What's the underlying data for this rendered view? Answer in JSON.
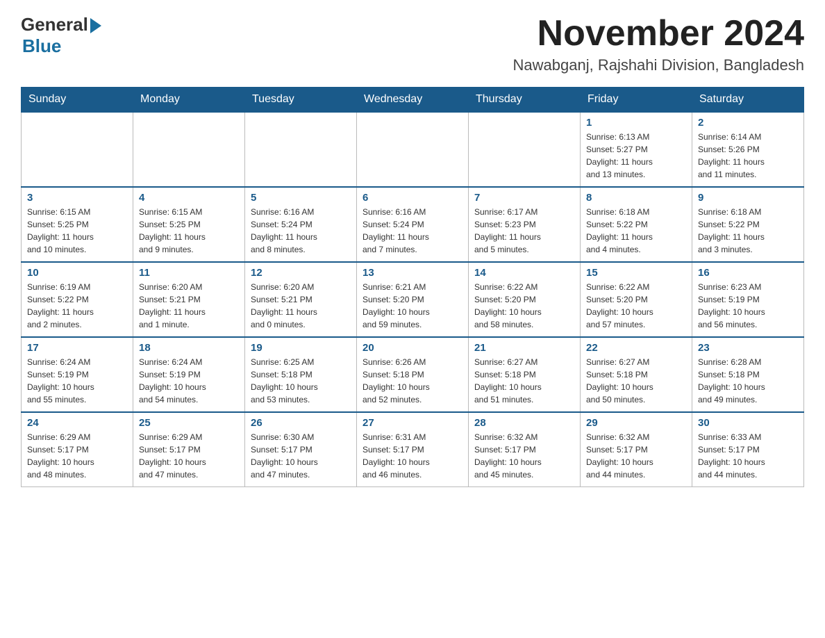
{
  "header": {
    "logo_general": "General",
    "logo_blue": "Blue",
    "month_year": "November 2024",
    "location": "Nawabganj, Rajshahi Division, Bangladesh"
  },
  "weekdays": [
    "Sunday",
    "Monday",
    "Tuesday",
    "Wednesday",
    "Thursday",
    "Friday",
    "Saturday"
  ],
  "weeks": [
    [
      {
        "day": "",
        "info": ""
      },
      {
        "day": "",
        "info": ""
      },
      {
        "day": "",
        "info": ""
      },
      {
        "day": "",
        "info": ""
      },
      {
        "day": "",
        "info": ""
      },
      {
        "day": "1",
        "info": "Sunrise: 6:13 AM\nSunset: 5:27 PM\nDaylight: 11 hours\nand 13 minutes."
      },
      {
        "day": "2",
        "info": "Sunrise: 6:14 AM\nSunset: 5:26 PM\nDaylight: 11 hours\nand 11 minutes."
      }
    ],
    [
      {
        "day": "3",
        "info": "Sunrise: 6:15 AM\nSunset: 5:25 PM\nDaylight: 11 hours\nand 10 minutes."
      },
      {
        "day": "4",
        "info": "Sunrise: 6:15 AM\nSunset: 5:25 PM\nDaylight: 11 hours\nand 9 minutes."
      },
      {
        "day": "5",
        "info": "Sunrise: 6:16 AM\nSunset: 5:24 PM\nDaylight: 11 hours\nand 8 minutes."
      },
      {
        "day": "6",
        "info": "Sunrise: 6:16 AM\nSunset: 5:24 PM\nDaylight: 11 hours\nand 7 minutes."
      },
      {
        "day": "7",
        "info": "Sunrise: 6:17 AM\nSunset: 5:23 PM\nDaylight: 11 hours\nand 5 minutes."
      },
      {
        "day": "8",
        "info": "Sunrise: 6:18 AM\nSunset: 5:22 PM\nDaylight: 11 hours\nand 4 minutes."
      },
      {
        "day": "9",
        "info": "Sunrise: 6:18 AM\nSunset: 5:22 PM\nDaylight: 11 hours\nand 3 minutes."
      }
    ],
    [
      {
        "day": "10",
        "info": "Sunrise: 6:19 AM\nSunset: 5:22 PM\nDaylight: 11 hours\nand 2 minutes."
      },
      {
        "day": "11",
        "info": "Sunrise: 6:20 AM\nSunset: 5:21 PM\nDaylight: 11 hours\nand 1 minute."
      },
      {
        "day": "12",
        "info": "Sunrise: 6:20 AM\nSunset: 5:21 PM\nDaylight: 11 hours\nand 0 minutes."
      },
      {
        "day": "13",
        "info": "Sunrise: 6:21 AM\nSunset: 5:20 PM\nDaylight: 10 hours\nand 59 minutes."
      },
      {
        "day": "14",
        "info": "Sunrise: 6:22 AM\nSunset: 5:20 PM\nDaylight: 10 hours\nand 58 minutes."
      },
      {
        "day": "15",
        "info": "Sunrise: 6:22 AM\nSunset: 5:20 PM\nDaylight: 10 hours\nand 57 minutes."
      },
      {
        "day": "16",
        "info": "Sunrise: 6:23 AM\nSunset: 5:19 PM\nDaylight: 10 hours\nand 56 minutes."
      }
    ],
    [
      {
        "day": "17",
        "info": "Sunrise: 6:24 AM\nSunset: 5:19 PM\nDaylight: 10 hours\nand 55 minutes."
      },
      {
        "day": "18",
        "info": "Sunrise: 6:24 AM\nSunset: 5:19 PM\nDaylight: 10 hours\nand 54 minutes."
      },
      {
        "day": "19",
        "info": "Sunrise: 6:25 AM\nSunset: 5:18 PM\nDaylight: 10 hours\nand 53 minutes."
      },
      {
        "day": "20",
        "info": "Sunrise: 6:26 AM\nSunset: 5:18 PM\nDaylight: 10 hours\nand 52 minutes."
      },
      {
        "day": "21",
        "info": "Sunrise: 6:27 AM\nSunset: 5:18 PM\nDaylight: 10 hours\nand 51 minutes."
      },
      {
        "day": "22",
        "info": "Sunrise: 6:27 AM\nSunset: 5:18 PM\nDaylight: 10 hours\nand 50 minutes."
      },
      {
        "day": "23",
        "info": "Sunrise: 6:28 AM\nSunset: 5:18 PM\nDaylight: 10 hours\nand 49 minutes."
      }
    ],
    [
      {
        "day": "24",
        "info": "Sunrise: 6:29 AM\nSunset: 5:17 PM\nDaylight: 10 hours\nand 48 minutes."
      },
      {
        "day": "25",
        "info": "Sunrise: 6:29 AM\nSunset: 5:17 PM\nDaylight: 10 hours\nand 47 minutes."
      },
      {
        "day": "26",
        "info": "Sunrise: 6:30 AM\nSunset: 5:17 PM\nDaylight: 10 hours\nand 47 minutes."
      },
      {
        "day": "27",
        "info": "Sunrise: 6:31 AM\nSunset: 5:17 PM\nDaylight: 10 hours\nand 46 minutes."
      },
      {
        "day": "28",
        "info": "Sunrise: 6:32 AM\nSunset: 5:17 PM\nDaylight: 10 hours\nand 45 minutes."
      },
      {
        "day": "29",
        "info": "Sunrise: 6:32 AM\nSunset: 5:17 PM\nDaylight: 10 hours\nand 44 minutes."
      },
      {
        "day": "30",
        "info": "Sunrise: 6:33 AM\nSunset: 5:17 PM\nDaylight: 10 hours\nand 44 minutes."
      }
    ]
  ]
}
